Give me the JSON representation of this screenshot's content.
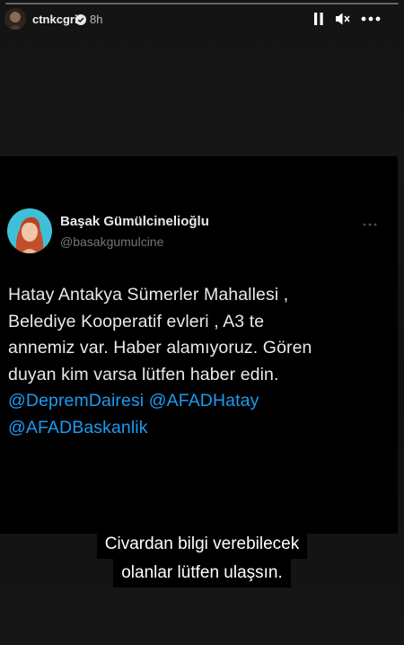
{
  "story": {
    "username": "ctnkcgri",
    "time": "8h",
    "controls": {
      "pause_icon": "pause-icon",
      "mute_icon": "speaker-muted-icon",
      "more_icon": "more-horizontal-icon"
    }
  },
  "tweet": {
    "name": "Başak Gümülcinelioğlu",
    "handle": "@basakgumulcine",
    "text_lines": [
      "Hatay Antakya Sümerler Mahallesi ,",
      "Belediye Kooperatif evleri , A3 te",
      "annemiz var. Haber alamıyoruz. Gören",
      "duyan kim varsa lütfen haber edin."
    ],
    "mentions": [
      "@DepremDairesi",
      "@AFADHatay",
      "@AFADBaskanlik"
    ],
    "colors": {
      "mention": "#1d9bf0",
      "text": "#e7e9ea",
      "handle": "#71767b"
    }
  },
  "caption": {
    "line1": "Civardan bilgi verebilecek",
    "line2": "olanlar lütfen ulaşsın."
  }
}
